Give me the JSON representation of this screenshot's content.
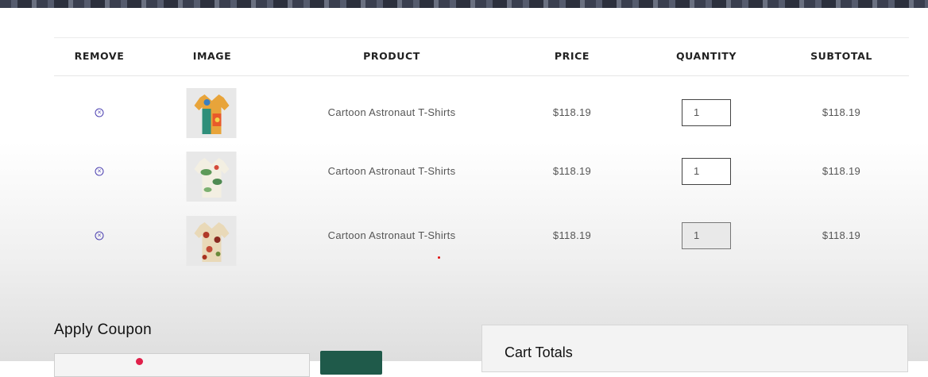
{
  "table": {
    "headers": {
      "remove": "REMOVE",
      "image": "IMAGE",
      "product": "PRODUCT",
      "price": "PRICE",
      "quantity": "QUANTITY",
      "subtotal": "SUBTOTAL"
    },
    "rows": [
      {
        "product": "Cartoon Astronaut T-Shirts",
        "price": "$118.19",
        "quantity": "1",
        "subtotal": "$118.19",
        "image_icon": "shirt-icon"
      },
      {
        "product": "Cartoon Astronaut T-Shirts",
        "price": "$118.19",
        "quantity": "1",
        "subtotal": "$118.19",
        "image_icon": "shirt-icon"
      },
      {
        "product": "Cartoon Astronaut T-Shirts",
        "price": "$118.19",
        "quantity": "1",
        "subtotal": "$118.19",
        "image_icon": "shirt-icon"
      }
    ],
    "remove_icon": "remove-circle-icon"
  },
  "coupon": {
    "title": "Apply Coupon"
  },
  "totals": {
    "title": "Cart Totals"
  },
  "colors": {
    "remove_icon": "#4b3fb0",
    "apply_button": "#1f5a4a"
  }
}
